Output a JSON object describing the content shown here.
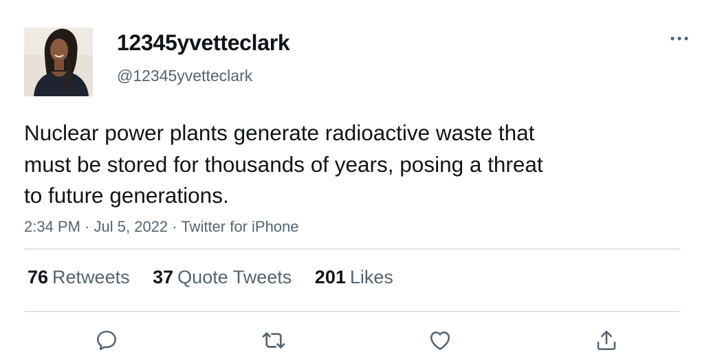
{
  "user": {
    "display_name": "12345yvetteclark",
    "handle": "@12345yvetteclark"
  },
  "tweet": {
    "lines": [
      "Nuclear power plants generate radioactive waste that",
      "must be stored for thousands of years, posing a threat",
      "to future generations."
    ],
    "time": "2:34 PM",
    "date": "Jul 5, 2022",
    "source": "Twitter for iPhone",
    "separator": "·"
  },
  "stats": {
    "retweets": {
      "count": "76",
      "label": "Retweets"
    },
    "quotes": {
      "count": "37",
      "label": "Quote Tweets"
    },
    "likes": {
      "count": "201",
      "label": "Likes"
    }
  },
  "icons": {
    "more": "more-horizontal-icon",
    "reply": "reply-icon",
    "retweet": "retweet-icon",
    "like": "heart-icon",
    "share": "share-icon"
  },
  "colors": {
    "text": "#0f1419",
    "secondary": "#536471",
    "divider": "#dfe3e6"
  }
}
